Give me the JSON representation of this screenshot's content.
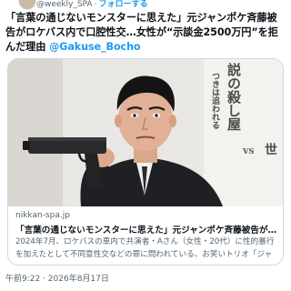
{
  "header": {
    "handle": "@weekly_SPA",
    "separator": "·",
    "follow_label": "フォローする"
  },
  "tweet": {
    "text_before_mention": "「言葉の通じないモンスターに思えた」元ジャンポケ斉藤被告がロケバス内で口腔性交…女性が“示談金2500万円”を拒んだ理由 ",
    "mention": "@Gakuse_Bocho"
  },
  "card": {
    "domain": "nikkan-spa.jp",
    "title": "「言葉の通じないモンスターに思えた」元ジャンポケ斉藤被告がロケバス内...",
    "description": "2024年7月、ロケバスの車内で共演者・Aさん（女性・20代）に性的暴行を加えたとして不同意性交などの罪に問われている、お笑いトリオ「ジャングル...",
    "image": {
      "banner_line1": "説の殺し屋",
      "banner_line2": "つきは追われる",
      "banner_vs": "vs",
      "banner_extra": "世"
    }
  },
  "timestamp": "午前9:22 · 2026年8月17日",
  "colors": {
    "link": "#1d9bf0",
    "text": "#0f1419",
    "muted": "#536471",
    "border": "#cfd9de"
  }
}
